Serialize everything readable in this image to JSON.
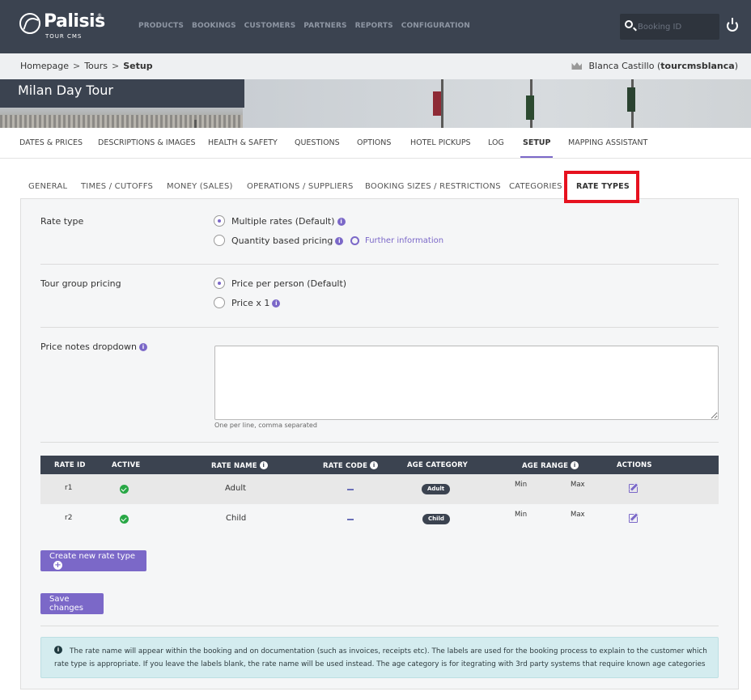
{
  "header": {
    "logo_text": "Palisis",
    "logo_sub": "TOUR CMS",
    "logo_sup": "®",
    "nav": [
      "PRODUCTS",
      "BOOKINGS",
      "CUSTOMERS",
      "PARTNERS",
      "REPORTS",
      "CONFIGURATION"
    ],
    "search_placeholder": "Booking ID"
  },
  "breadcrumb": {
    "items": [
      "Homepage",
      "Tours",
      "Setup"
    ],
    "separator": ">"
  },
  "user": {
    "name": "Blanca Castillo",
    "username": "tourcmsblanca"
  },
  "tour": {
    "title": "Milan Day Tour"
  },
  "main_tabs": [
    "DATES & PRICES",
    "DESCRIPTIONS & IMAGES",
    "HEALTH & SAFETY",
    "QUESTIONS",
    "OPTIONS",
    "HOTEL PICKUPS",
    "LOG",
    "SETUP",
    "MAPPING ASSISTANT"
  ],
  "main_tab_active": "SETUP",
  "sub_tabs": [
    "GENERAL",
    "TIMES / CUTOFFS",
    "MONEY (SALES)",
    "OPERATIONS / SUPPLIERS",
    "BOOKING SIZES / RESTRICTIONS",
    "CATEGORIES",
    "RATE TYPES"
  ],
  "sub_tab_active": "RATE TYPES",
  "rate_type": {
    "label": "Rate type",
    "options": [
      "Multiple rates (Default)",
      "Quantity based pricing"
    ],
    "selected": 0,
    "further_info": "Further information"
  },
  "group_pricing": {
    "label": "Tour group pricing",
    "options": [
      "Price per person (Default)",
      "Price x 1"
    ],
    "selected": 0
  },
  "price_notes": {
    "label": "Price notes dropdown",
    "value": "",
    "hint": "One per line, comma separated"
  },
  "table": {
    "headers": [
      "RATE ID",
      "ACTIVE",
      "RATE NAME",
      "RATE CODE",
      "AGE CATEGORY",
      "AGE RANGE",
      "ACTIONS"
    ],
    "rows": [
      {
        "id": "r1",
        "active": true,
        "name": "Adult",
        "code": "",
        "age_category": "Adult",
        "min": "Min",
        "max": "Max"
      },
      {
        "id": "r2",
        "active": true,
        "name": "Child",
        "code": "",
        "age_category": "Child",
        "min": "Min",
        "max": "Max"
      }
    ]
  },
  "buttons": {
    "create": "Create new rate type",
    "save": "Save changes"
  },
  "info_text": "The rate name will appear within the booking and on documentation (such as invoices, receipts etc). The labels are used for the booking process to explain to the customer which rate type is appropriate. If you leave the labels blank, the rate name will be used instead. The age category is for itegrating with 3rd party systems that require known age categories",
  "colors": {
    "header_bg": "#3b4350",
    "accent": "#7b68c8",
    "highlight_border": "#e6121f",
    "active_green": "#28a745",
    "info_bg": "#d4ecef"
  }
}
